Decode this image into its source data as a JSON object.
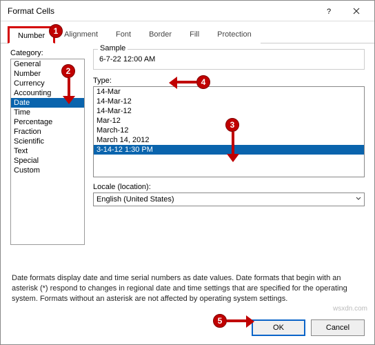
{
  "window": {
    "title": "Format Cells"
  },
  "tabs": [
    "Number",
    "Alignment",
    "Font",
    "Border",
    "Fill",
    "Protection"
  ],
  "active_tab": 0,
  "category": {
    "label": "Category:",
    "items": [
      "General",
      "Number",
      "Currency",
      "Accounting",
      "Date",
      "Time",
      "Percentage",
      "Fraction",
      "Scientific",
      "Text",
      "Special",
      "Custom"
    ],
    "selected": 4
  },
  "sample": {
    "label": "Sample",
    "value": "6-7-22 12:00 AM"
  },
  "type": {
    "label": "Type:",
    "items": [
      "14-Mar",
      "14-Mar-12",
      "14-Mar-12",
      "Mar-12",
      "March-12",
      "March 14, 2012",
      "3-14-12 1:30 PM"
    ],
    "selected": 6
  },
  "locale": {
    "label": "Locale (location):",
    "value": "English (United States)"
  },
  "description": "Date formats display date and time serial numbers as date values. Date formats that begin with an asterisk (*) respond to changes in regional date and time settings that are specified for the operating system. Formats without an asterisk are not affected by operating system settings.",
  "buttons": {
    "ok": "OK",
    "cancel": "Cancel"
  },
  "badges": [
    "1",
    "2",
    "3",
    "4",
    "5"
  ],
  "watermark": "wsxdn.com"
}
